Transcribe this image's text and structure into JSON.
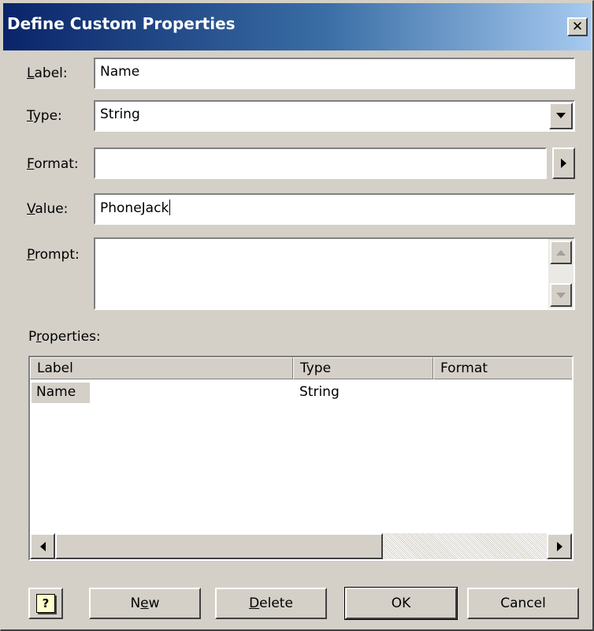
{
  "window": {
    "title": "Define Custom Properties",
    "close_glyph": "✕"
  },
  "form": {
    "label": {
      "access_key": "L",
      "rest": "abel:",
      "value": "Name"
    },
    "type": {
      "access_key": "T",
      "rest": "ype:",
      "value": "String"
    },
    "format": {
      "access_key": "F",
      "rest": "ormat:",
      "value": ""
    },
    "value": {
      "access_key": "V",
      "rest": "alue:",
      "value": "PhoneJack"
    },
    "prompt": {
      "access_key": "P",
      "rest": "rompt:",
      "value": ""
    }
  },
  "properties": {
    "label_prefix": "P",
    "label_key": "r",
    "label_rest": "operties:",
    "columns": [
      "Label",
      "Type",
      "Format"
    ],
    "rows": [
      {
        "label": "Name",
        "type": "String",
        "format": ""
      }
    ]
  },
  "buttons": {
    "help_glyph": "?",
    "new": {
      "before": "N",
      "key": "e",
      "after": "w"
    },
    "delete": {
      "key": "D",
      "after": "elete"
    },
    "ok": "OK",
    "cancel": "Cancel"
  },
  "icons": {
    "dropdown": "chevron-down-icon",
    "format_menu": "chevron-right-icon",
    "scroll_up": "triangle-up-icon",
    "scroll_down": "triangle-down-icon",
    "scroll_left": "triangle-left-icon",
    "scroll_right": "triangle-right-icon",
    "help": "help-icon"
  },
  "colors": {
    "title_start": "#0a246a",
    "title_end": "#a6caf0",
    "face": "#d4d0c8",
    "selection": "#d4d0c8"
  }
}
